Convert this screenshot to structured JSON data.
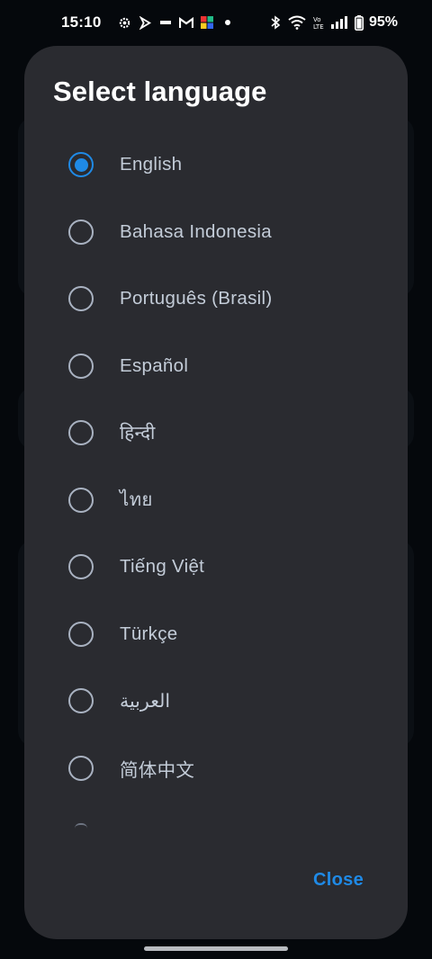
{
  "status_bar": {
    "time": "15:10",
    "battery_percent": "95%",
    "icons": [
      "settings-gear-icon",
      "play-arrow-icon",
      "radio-icon",
      "gmail-icon",
      "app-icon",
      "notification-dot-icon",
      "bluetooth-icon",
      "wifi-icon",
      "volte-icon",
      "signal-icon",
      "battery-icon"
    ]
  },
  "dialog": {
    "title": "Select language",
    "selected": "English",
    "languages": [
      {
        "label": "English",
        "selected": true
      },
      {
        "label": "Bahasa Indonesia",
        "selected": false
      },
      {
        "label": "Português (Brasil)",
        "selected": false
      },
      {
        "label": "Español",
        "selected": false
      },
      {
        "label": "हिन्दी",
        "selected": false
      },
      {
        "label": "ไทย",
        "selected": false
      },
      {
        "label": "Tiếng Việt",
        "selected": false
      },
      {
        "label": "Türkçe",
        "selected": false
      },
      {
        "label": "العربية",
        "selected": false
      },
      {
        "label": "简体中文",
        "selected": false
      }
    ],
    "close_label": "Close"
  },
  "colors": {
    "accent": "#1f8ae6",
    "dialog_bg": "#2a2b30",
    "screen_bg": "#05080c",
    "radio_unchecked": "#a9b2c1",
    "label": "#c3ccd8"
  }
}
